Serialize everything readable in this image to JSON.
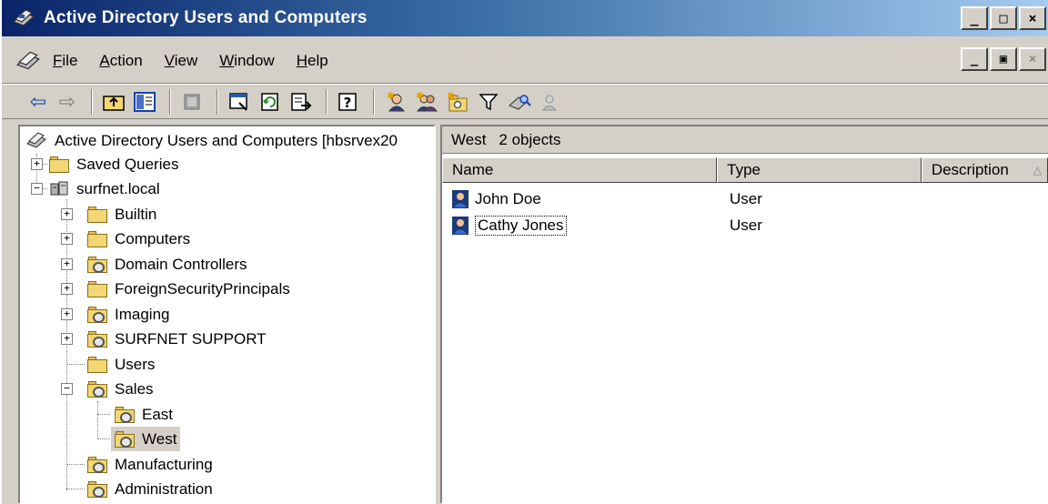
{
  "window": {
    "title": "Active Directory Users and Computers"
  },
  "caption_buttons": {
    "minimize": "_",
    "maximize": "□",
    "close": "×"
  },
  "menu": {
    "items": [
      {
        "label": "File",
        "accel": "F",
        "rest": "ile"
      },
      {
        "label": "Action",
        "accel": "A",
        "rest": "ction"
      },
      {
        "label": "View",
        "accel": "V",
        "rest": "iew"
      },
      {
        "label": "Window",
        "accel": "W",
        "rest": "indow"
      },
      {
        "label": "Help",
        "accel": "H",
        "rest": "elp"
      }
    ],
    "mdi_buttons": {
      "minimize": "_",
      "restore": "▣",
      "close": "×"
    }
  },
  "toolbar": {
    "icons": [
      "back-arrow-icon",
      "forward-arrow-icon",
      "up-folder-icon",
      "show-hide-tree-icon",
      "delete-icon",
      "properties-icon",
      "refresh-icon",
      "export-list-icon",
      "help-icon",
      "new-user-icon",
      "new-group-icon",
      "new-ou-icon",
      "filter-icon",
      "find-icon",
      "add-to-group-icon"
    ]
  },
  "tree": {
    "root_label": "Active Directory Users and Computers [hbsrvex20",
    "items": [
      {
        "label": "Saved Queries",
        "level": 1,
        "expander": "+"
      },
      {
        "label": "surfnet.local",
        "level": 1,
        "expander": "−"
      },
      {
        "label": "Builtin",
        "level": 2,
        "expander": "+"
      },
      {
        "label": "Computers",
        "level": 2,
        "expander": "+"
      },
      {
        "label": "Domain Controllers",
        "level": 2,
        "expander": "+"
      },
      {
        "label": "ForeignSecurityPrincipals",
        "level": 2,
        "expander": "+"
      },
      {
        "label": "Imaging",
        "level": 2,
        "expander": "+"
      },
      {
        "label": "SURFNET SUPPORT",
        "level": 2,
        "expander": "+"
      },
      {
        "label": "Users",
        "level": 2,
        "expander": ""
      },
      {
        "label": "Sales",
        "level": 2,
        "expander": "−"
      },
      {
        "label": "East",
        "level": 3,
        "expander": ""
      },
      {
        "label": "West",
        "level": 3,
        "expander": "",
        "selected": true
      },
      {
        "label": "Manufacturing",
        "level": 2,
        "expander": ""
      },
      {
        "label": "Administration",
        "level": 2,
        "expander": ""
      }
    ]
  },
  "details": {
    "container": "West",
    "count_text": "2 objects",
    "columns": [
      "Name",
      "Type",
      "Description"
    ],
    "sort_indicator": "△",
    "rows": [
      {
        "name": "John Doe",
        "type": "User",
        "description": ""
      },
      {
        "name": "Cathy Jones",
        "type": "User",
        "description": ""
      }
    ]
  }
}
